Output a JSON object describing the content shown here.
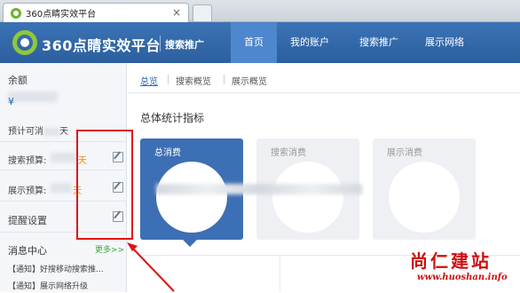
{
  "browser": {
    "tab_title": "360点睛实效平台",
    "tab_close": "×"
  },
  "header": {
    "brand": "360点睛实效平台",
    "brand_sub": "搜索推广",
    "nav": [
      "首页",
      "我的账户",
      "搜索推广",
      "展示网络"
    ],
    "active_nav": "首页",
    "accent_color": "#2c5f9e"
  },
  "sidebar": {
    "balance_label": "余额",
    "balance_currency": "¥",
    "days_label": "预计可消",
    "days_suffix": "天",
    "search_budget_label": "搜索预算:",
    "search_budget_suffix": "天",
    "display_budget_label": "展示预算:",
    "display_budget_suffix": "天",
    "reminder_label": "提醒设置",
    "message_center": "消息中心",
    "more_link": "更多>>",
    "notices": [
      "【通知】好搜移动搜索推...",
      "【通知】展示网络升级"
    ]
  },
  "main": {
    "subtabs": [
      "总览",
      "搜索概览",
      "展示概览"
    ],
    "active_subtab": "总览",
    "stats_title": "总体统计指标",
    "cards": [
      "总消费",
      "搜索消费",
      "展示消费"
    ]
  },
  "watermark": {
    "text": "尚仁建站",
    "url": "www.huoshan.info"
  },
  "icons": {
    "edit": "edit-icon",
    "tab_logo": "360-logo-icon"
  }
}
